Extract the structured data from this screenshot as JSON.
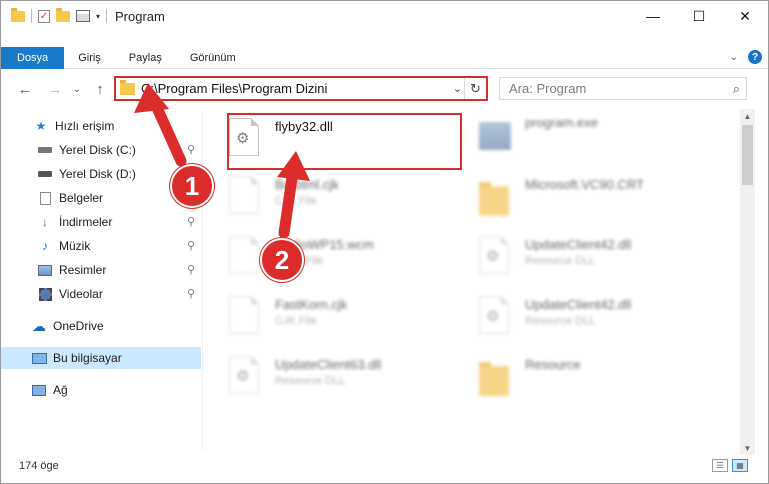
{
  "window": {
    "title": "Program",
    "minimize": "—",
    "maximize": "☐",
    "close": "✕"
  },
  "ribbon": {
    "tabs": [
      "Dosya",
      "Giriş",
      "Paylaş",
      "Görünüm"
    ],
    "expand": "⌄",
    "help": "?"
  },
  "nav": {
    "back": "←",
    "forward": "→",
    "recent": "⌄",
    "up": "↑",
    "address": "C:\\Program Files\\Program Dizini",
    "address_dropdown": "⌄",
    "refresh": "↻",
    "search_placeholder": "Ara: Program",
    "search_icon": "⌕"
  },
  "sidebar": {
    "items": [
      {
        "label": "Hızlı erişim",
        "icon": "star-icon",
        "pinned": false
      },
      {
        "label": "Yerel Disk (C:)",
        "icon": "drive-icon",
        "pinned": true
      },
      {
        "label": "Yerel Disk (D:)",
        "icon": "drive-icon",
        "pinned": false
      },
      {
        "label": "Belgeler",
        "icon": "documents-icon",
        "pinned": true
      },
      {
        "label": "İndirmeler",
        "icon": "download-icon",
        "pinned": true
      },
      {
        "label": "Müzik",
        "icon": "music-icon",
        "pinned": true
      },
      {
        "label": "Resimler",
        "icon": "pictures-icon",
        "pinned": true
      },
      {
        "label": "Videolar",
        "icon": "videos-icon",
        "pinned": true
      },
      {
        "label": "OneDrive",
        "icon": "cloud-icon",
        "pinned": false
      },
      {
        "label": "Bu bilgisayar",
        "icon": "computer-icon",
        "pinned": false,
        "selected": true
      },
      {
        "label": "Ağ",
        "icon": "network-icon",
        "pinned": false
      }
    ],
    "pin_glyph": "📌"
  },
  "files": [
    {
      "name": "flyby32.dll",
      "type": "",
      "icon": "dll-gear-icon",
      "highlighted": true
    },
    {
      "name": "program.exe",
      "type": "",
      "icon": "exe-icon",
      "blurred": true
    },
    {
      "name": "Botbtml.cjk",
      "type": "CJK File",
      "icon": "document-icon",
      "blurred": true
    },
    {
      "name": "Microsoft.VC90.CRT",
      "type": "",
      "icon": "folder-icon",
      "blurred": true
    },
    {
      "name": "AudioWP15.wcm",
      "type": "WCM File",
      "icon": "document-icon",
      "blurred": true
    },
    {
      "name": "UpdateClient42.dll",
      "type": "Resource DLL",
      "icon": "dll-gear-icon",
      "blurred": true
    },
    {
      "name": "FastKorn.cjk",
      "type": "CJK File",
      "icon": "document-icon",
      "blurred": true
    },
    {
      "name": "UpdateClient42.dll",
      "type": "Resource DLL",
      "icon": "dll-gear-icon",
      "blurred": true
    },
    {
      "name": "UpdateClient63.dll",
      "type": "Resource DLL",
      "icon": "dll-gear-icon",
      "blurred": true
    },
    {
      "name": "Resource",
      "type": "",
      "icon": "folder-icon",
      "blurred": true
    }
  ],
  "status": {
    "count": "174 öge"
  },
  "annotations": {
    "step1": "1",
    "step2": "2",
    "color": "#dc2b2b"
  }
}
